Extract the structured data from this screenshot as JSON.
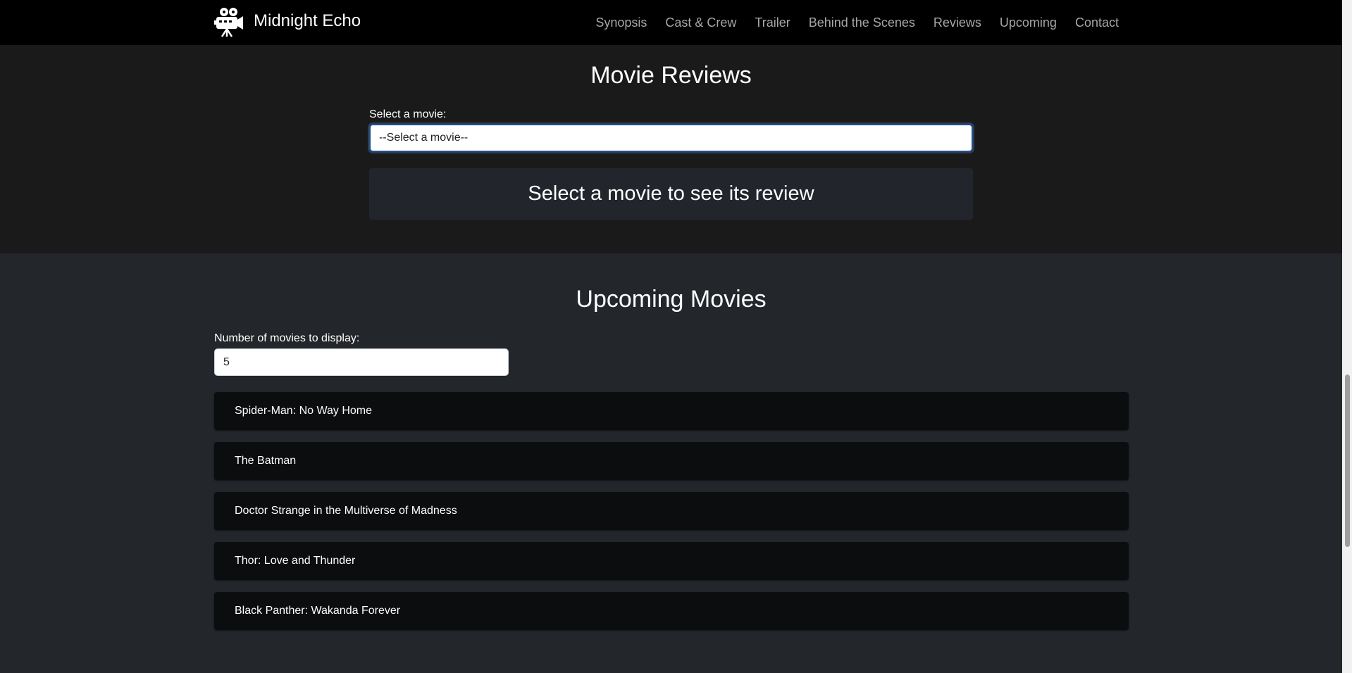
{
  "nav": {
    "brand": "Midnight Echo",
    "links": [
      "Synopsis",
      "Cast & Crew",
      "Trailer",
      "Behind the Scenes",
      "Reviews",
      "Upcoming",
      "Contact"
    ]
  },
  "reviews": {
    "title": "Movie Reviews",
    "select_label": "Select a movie:",
    "select_value": "--Select a movie--",
    "placeholder": "Select a movie to see its review"
  },
  "upcoming": {
    "title": "Upcoming Movies",
    "count_label": "Number of movies to display:",
    "count_value": "5",
    "movies": [
      "Spider-Man: No Way Home",
      "The Batman",
      "Doctor Strange in the Multiverse of Madness",
      "Thor: Love and Thunder",
      "Black Panther: Wakanda Forever"
    ]
  },
  "colors": {
    "navbar_bg": "#000000",
    "reviews_bg": "#1a1a1a",
    "upcoming_bg": "#23262b",
    "card_bg": "#0c0d0f",
    "nav_link": "#a6a6a6"
  },
  "icons": {
    "brand": "movie-camera-icon"
  }
}
